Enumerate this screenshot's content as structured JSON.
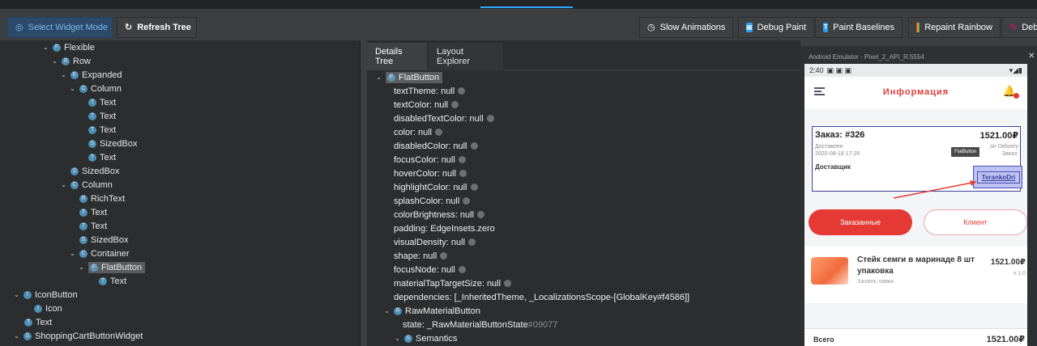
{
  "toolbar": {
    "select_widget_mode": "Select Widget Mode",
    "refresh_tree": "Refresh Tree",
    "slow_animations": "Slow Animations",
    "debug_paint": "Debug Paint",
    "paint_baselines": "Paint Baselines",
    "repaint_rainbow": "Repaint Rainbow",
    "debug_truncated": "Deb"
  },
  "widget_tree": [
    {
      "label": "Flexible",
      "icon": "F"
    },
    {
      "label": "Row",
      "icon": "R"
    },
    {
      "label": "Expanded",
      "icon": "E"
    },
    {
      "label": "Column",
      "icon": "C"
    },
    {
      "label": "Text",
      "icon": "T"
    },
    {
      "label": "Text",
      "icon": "T"
    },
    {
      "label": "Text",
      "icon": "T"
    },
    {
      "label": "SizedBox",
      "icon": "S"
    },
    {
      "label": "Text",
      "icon": "T"
    },
    {
      "label": "SizedBox",
      "icon": "S"
    },
    {
      "label": "Column",
      "icon": "C"
    },
    {
      "label": "RichText",
      "icon": "R"
    },
    {
      "label": "Text",
      "icon": "T"
    },
    {
      "label": "Text",
      "icon": "T"
    },
    {
      "label": "SizedBox",
      "icon": "S"
    },
    {
      "label": "Container",
      "icon": "C"
    },
    {
      "label": "FlatButton",
      "icon": "F"
    },
    {
      "label": "Text",
      "icon": "T"
    },
    {
      "label": "IconButton",
      "icon": "I"
    },
    {
      "label": "Icon",
      "icon": "I"
    },
    {
      "label": "Text",
      "icon": "T"
    },
    {
      "label": "ShoppingCartButtonWidget",
      "icon": "S"
    }
  ],
  "details": {
    "tab_details": "Details Tree",
    "tab_layout": "Layout Explorer",
    "root": "FlatButton",
    "props": [
      "textTheme: null",
      "textColor: null",
      "disabledTextColor: null",
      "color: null",
      "disabledColor: null",
      "focusColor: null",
      "hoverColor: null",
      "highlightColor: null",
      "splashColor: null",
      "colorBrightness: null",
      "padding: EdgeInsets.zero",
      "visualDensity: null",
      "shape: null",
      "focusNode: null",
      "materialTapTargetSize: null",
      "dependencies: [_InheritedTheme, _LocalizationsScope-[GlobalKey#f4586]]"
    ],
    "raw_material_button": "RawMaterialButton",
    "state_label": "state: _RawMaterialButtonState",
    "state_hash": "#09077",
    "semantics": "Semantics"
  },
  "emulator": {
    "window_title": "Android Emulator - Pixel_2_API_R:5554",
    "time": "2:40",
    "app_title": "Информация",
    "order": {
      "number": "Заказ: #326",
      "price": "1521.00₽",
      "status": "Доставлен",
      "date": "2020-08-18 17:26",
      "courier": "Доставщик",
      "delivery": "on Delivery",
      "order_label": "Заказ:"
    },
    "tooltip": "FlatButton",
    "flat_button_text": "TerankoDri",
    "btn_ordered": "Заказанные",
    "btn_client": "Клиент",
    "item": {
      "name": "Стейк семги в маринаде 8 шт упаковка",
      "shop": "Халяль лавка",
      "price": "1521.00₽",
      "qty": "x 1.0"
    },
    "total_label": "Всего",
    "total_price": "1521.00₽"
  },
  "colors": {
    "accent": "#2ea8ff",
    "app_red": "#e53935",
    "highlight_blue": "#3b3f9e"
  }
}
